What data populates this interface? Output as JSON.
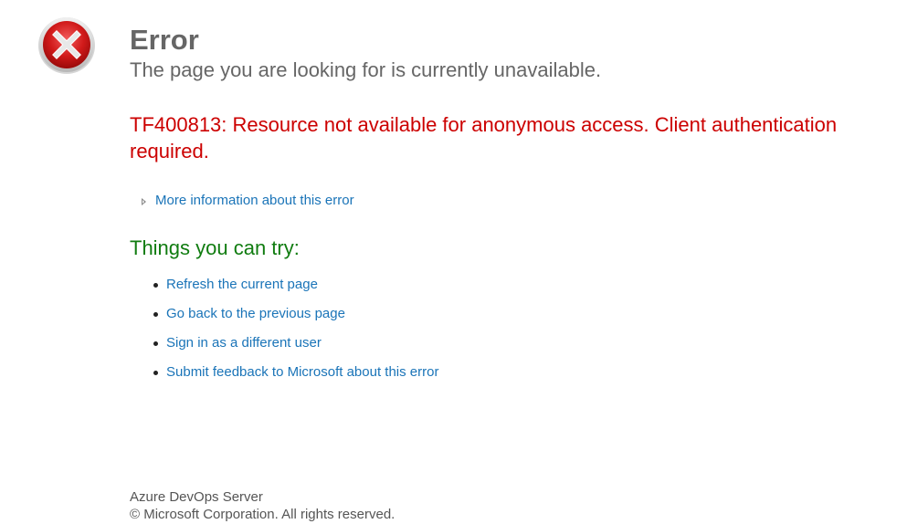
{
  "header": {
    "title": "Error",
    "subtitle": "The page you are looking for is currently unavailable.",
    "icon": "error-x-icon"
  },
  "error": {
    "message": "TF400813: Resource not available for anonymous access. Client authentication required."
  },
  "more_info": {
    "label": "More information about this error",
    "icon": "expand-triangle-icon"
  },
  "try": {
    "heading": "Things you can try:",
    "items": [
      "Refresh the current page",
      "Go back to the previous page",
      "Sign in as a different user",
      "Submit feedback to Microsoft about this error"
    ]
  },
  "footer": {
    "product": "Azure DevOps Server",
    "copyright": "© Microsoft Corporation. All rights reserved."
  },
  "colors": {
    "error_red": "#cc0000",
    "heading_gray": "#666666",
    "link_blue": "#1a74b8",
    "try_green": "#107c10"
  }
}
